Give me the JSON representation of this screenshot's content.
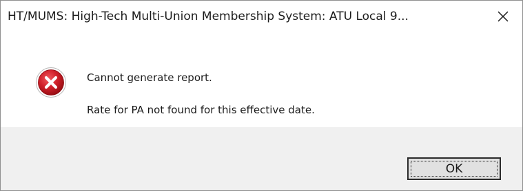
{
  "window": {
    "title": "HT/MUMS: High-Tech Multi-Union Membership System: ATU Local 9..."
  },
  "titlebar": {
    "close_icon": "close-icon"
  },
  "dialog": {
    "icon": "error-icon",
    "message_line1": "Cannot generate report.",
    "message_line2": "Rate for PA not found for this effective date."
  },
  "buttons": {
    "ok_label": "OK"
  },
  "colors": {
    "error_red": "#c4161c",
    "footer_bg": "#f0f0f0",
    "button_bg": "#e1e1e1"
  }
}
